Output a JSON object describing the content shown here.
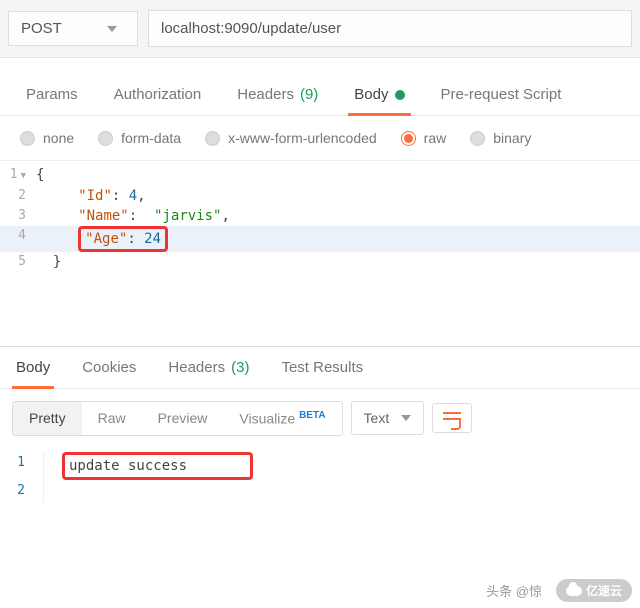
{
  "request": {
    "method": "POST",
    "url": "localhost:9090/update/user"
  },
  "tabs": {
    "params": "Params",
    "authorization": "Authorization",
    "headers": "Headers",
    "headers_count": "(9)",
    "body": "Body",
    "prerequest": "Pre-request Script"
  },
  "body_types": {
    "none": "none",
    "formdata": "form-data",
    "xwww": "x-www-form-urlencoded",
    "raw": "raw",
    "binary": "binary"
  },
  "editor": {
    "l1": "{",
    "l2_key": "\"Id\"",
    "l2_sep": ": ",
    "l2_val": "4",
    "l2_end": ",",
    "l3_key": "\"Name\"",
    "l3_sep": ":  ",
    "l3_val": "\"jarvis\"",
    "l3_end": ",",
    "l4_key": "\"Age\"",
    "l4_sep": ": ",
    "l4_val": "24",
    "l5": "}"
  },
  "response_tabs": {
    "body": "Body",
    "cookies": "Cookies",
    "headers": "Headers",
    "headers_count": "(3)",
    "testresults": "Test Results"
  },
  "resp_toolbar": {
    "pretty": "Pretty",
    "raw": "Raw",
    "preview": "Preview",
    "visualize": "Visualize",
    "beta": "BETA",
    "text": "Text"
  },
  "response_body": {
    "line1": "update success"
  },
  "watermark": {
    "t1": "头条 @惊",
    "t2": "亿速云"
  }
}
